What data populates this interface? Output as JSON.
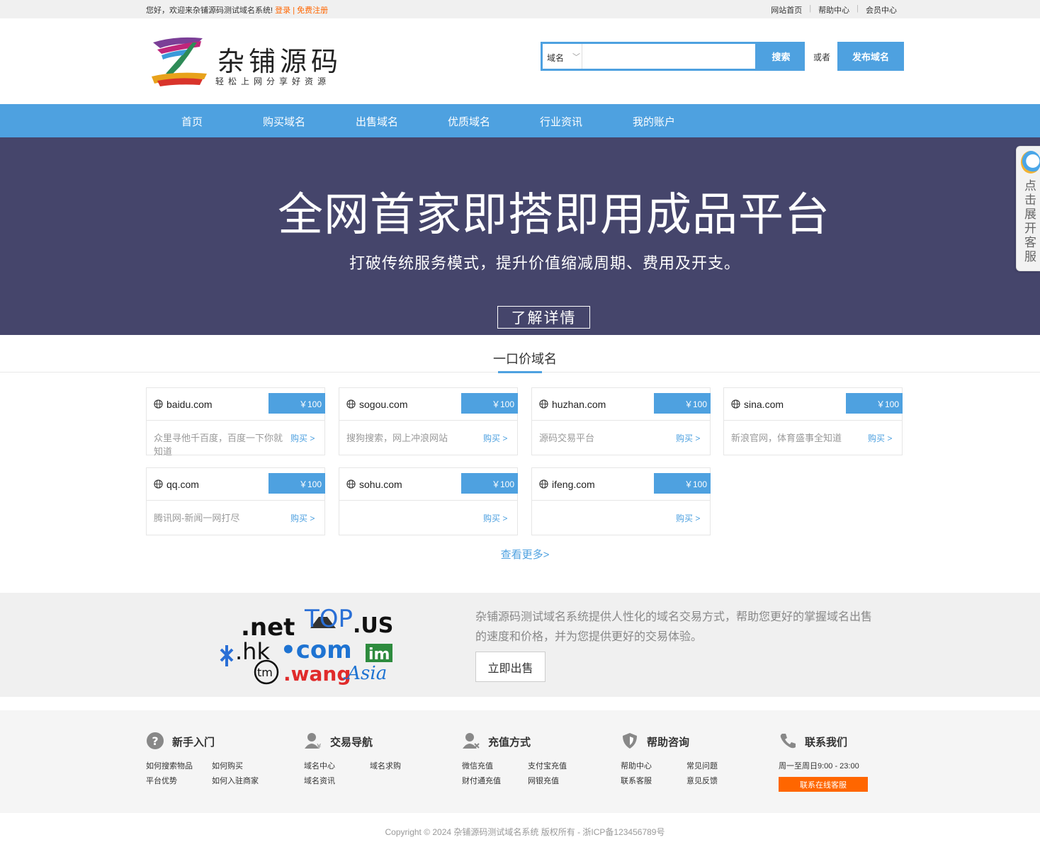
{
  "topbar": {
    "welcome": "您好，欢迎来杂铺源码测试域名系统!",
    "login": "登录",
    "sep": "|",
    "register": "免费注册",
    "links": [
      "网站首页",
      "帮助中心",
      "会员中心"
    ]
  },
  "header": {
    "logo_title": "杂铺源码",
    "logo_sub": "轻松上网分享好资源",
    "search_type": "域名",
    "search_value": "",
    "search_button": "搜索",
    "or_text": "或者",
    "publish_button": "发布域名"
  },
  "nav": [
    "首页",
    "购买域名",
    "出售域名",
    "优质域名",
    "行业资讯",
    "我的账户"
  ],
  "banner": {
    "title": "全网首家即搭即用成品平台",
    "subtitle": "打破传统服务模式，提升价值缩减周期、费用及开支。",
    "button": "了解详情"
  },
  "service_tab": {
    "text": "点击展开客服",
    "icon": "qq-service-icon"
  },
  "section": {
    "title": "一口价域名",
    "more": "查看更多>"
  },
  "domains": [
    {
      "name": "baidu.com",
      "price": "￥100",
      "desc": "众里寻他千百度，百度一下你就知道",
      "buy": "购买 >"
    },
    {
      "name": "sogou.com",
      "price": "￥100",
      "desc": "搜狗搜索，网上冲浪网站",
      "buy": "购买 >"
    },
    {
      "name": "huzhan.com",
      "price": "￥100",
      "desc": "源码交易平台",
      "buy": "购买 >"
    },
    {
      "name": "sina.com",
      "price": "￥100",
      "desc": "新浪官网，体育盛事全知道",
      "buy": "购买 >"
    },
    {
      "name": "qq.com",
      "price": "￥100",
      "desc": "腾讯网-新闻一网打尽",
      "buy": "购买 >"
    },
    {
      "name": "sohu.com",
      "price": "￥100",
      "desc": "",
      "buy": "购买 >"
    },
    {
      "name": "ifeng.com",
      "price": "￥100",
      "desc": "",
      "buy": "购买 >"
    }
  ],
  "promo": {
    "text": "杂铺源码测试域名系统提供人性化的域名交易方式，帮助您更好的掌握域名出售的速度和价格，并为您提供更好的交易体验。",
    "button": "立即出售",
    "art_labels": [
      ".net",
      "TOP",
      ".US",
      ".hk",
      "•com",
      "im",
      "tm",
      ".wang",
      ".Asia"
    ]
  },
  "footer": {
    "cols": [
      {
        "title": "新手入门",
        "icon": "question-icon",
        "links": [
          "如何搜索物品",
          "如何购买",
          "平台优势",
          "如何入驻商家"
        ]
      },
      {
        "title": "交易导航",
        "icon": "user-trade-icon",
        "links": [
          "域名中心",
          "域名求购",
          "域名资讯"
        ]
      },
      {
        "title": "充值方式",
        "icon": "user-recharge-icon",
        "links": [
          "微信充值",
          "支付宝充值",
          "财付通充值",
          "网银充值"
        ]
      },
      {
        "title": "帮助咨询",
        "icon": "shield-icon",
        "links": [
          "帮助中心",
          "常见问题",
          "联系客服",
          "意见反馈"
        ]
      },
      {
        "title": "联系我们",
        "icon": "phone-icon",
        "links": [
          "周一至周日9:00 - 23:00"
        ],
        "button": "联系在线客服"
      }
    ],
    "copyright": "Copyright © 2024 杂铺源码测试域名系统 版权所有 - 浙ICP备123456789号"
  }
}
